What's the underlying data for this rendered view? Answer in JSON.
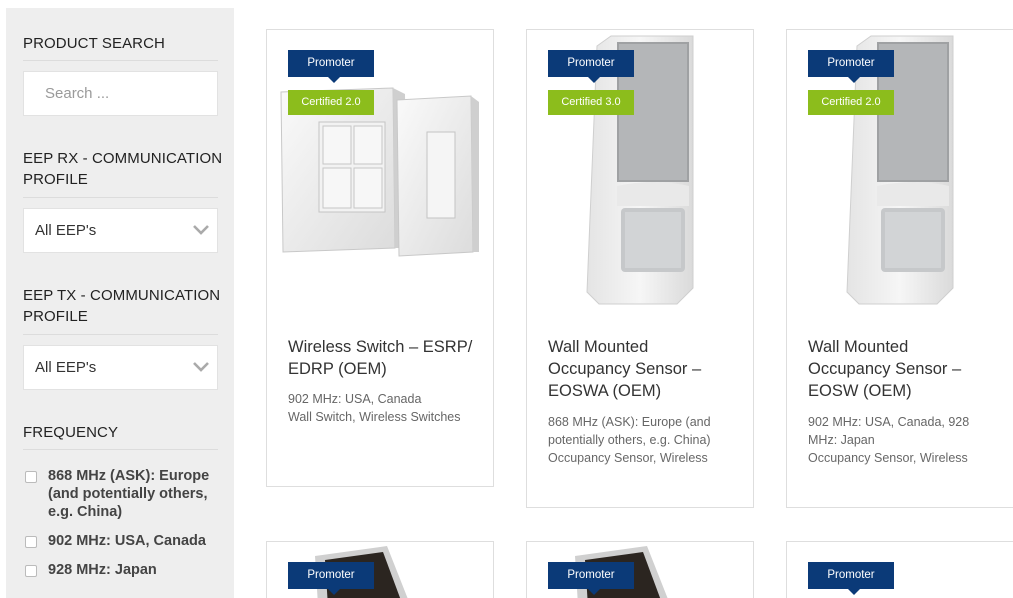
{
  "sidebar": {
    "product_search_heading": "PRODUCT SEARCH",
    "search_placeholder": "Search ...",
    "eep_rx_heading_line1": "EEP RX - COMMUNICATION",
    "eep_rx_heading_line2": "PROFILE",
    "eep_rx_selected": "All EEP's",
    "eep_tx_heading_line1": "EEP TX - COMMUNICATION",
    "eep_tx_heading_line2": "PROFILE",
    "eep_tx_selected": "All EEP's",
    "frequency_heading": "FREQUENCY",
    "frequency_options": [
      "868 MHz (ASK): Europe (and potentially others, e.g. China)",
      "902 MHz: USA, Canada",
      "928 MHz: Japan"
    ]
  },
  "products": [
    {
      "badge": "Promoter",
      "certified": "Certified 2.0",
      "title_line1": "Wireless Switch – ESRP/",
      "title_line2": "EDRP (OEM)",
      "frequency_line1": "902 MHz: USA, Canada",
      "frequency_line2": "",
      "categories": "Wall Switch, Wireless Switches",
      "image": "wall-switch-image"
    },
    {
      "badge": "Promoter",
      "certified": "Certified 3.0",
      "title_line1": "Wall Mounted",
      "title_line2": "Occupancy Sensor –",
      "title_line3": "EOSWA (OEM)",
      "frequency_line1": "868 MHz (ASK): Europe (and",
      "frequency_line2": "potentially others, e.g. China)",
      "categories": "Occupancy Sensor, Wireless",
      "image": "occupancy-sensor-image"
    },
    {
      "badge": "Promoter",
      "certified": "Certified 2.0",
      "title_line1": "Wall Mounted",
      "title_line2": "Occupancy Sensor –",
      "title_line3": "EOSW (OEM)",
      "frequency_line1": "902 MHz: USA, Canada, 928",
      "frequency_line2": "MHz: Japan",
      "categories": "Occupancy Sensor, Wireless",
      "image": "occupancy-sensor-image"
    }
  ],
  "products_row2": [
    {
      "badge": "Promoter",
      "image": "device-image"
    },
    {
      "badge": "Promoter",
      "image": "device-image"
    },
    {
      "badge": "Promoter",
      "image": ""
    }
  ],
  "colors": {
    "promoter_badge": "#0b3a78",
    "certified_badge": "#8cbd1c",
    "sidebar_bg": "#eeeeee"
  }
}
